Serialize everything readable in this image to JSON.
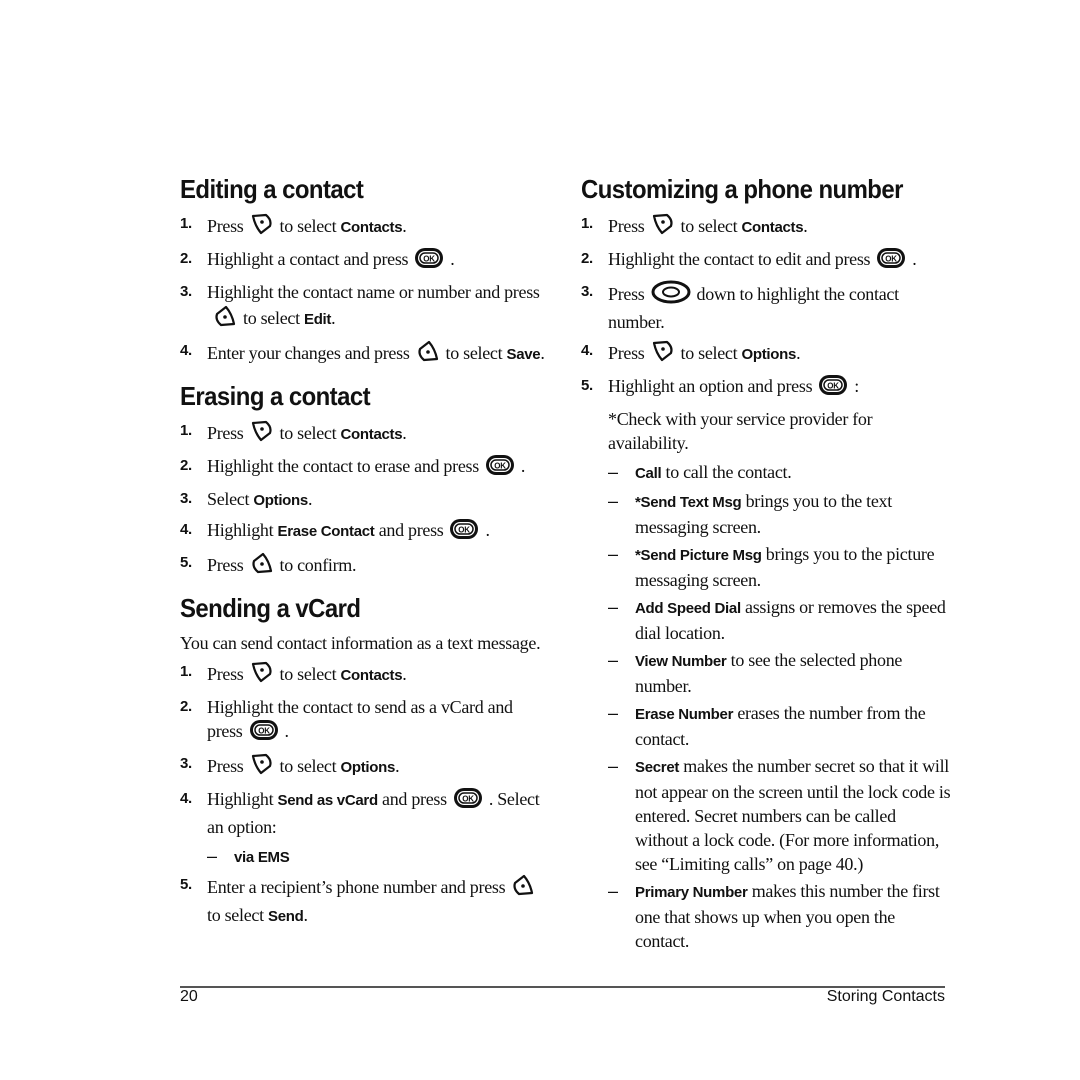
{
  "left_column": {
    "editing": {
      "title": "Editing a contact",
      "steps": [
        {
          "num": "1.",
          "a": "Press",
          "icon": "right-softkey-icon",
          "b": "to select ",
          "bold": "Contacts",
          "c": "."
        },
        {
          "num": "2.",
          "a": "Highlight a contact and press",
          "icon": "ok-key-icon",
          "c": "."
        },
        {
          "num": "3.",
          "a": "Highlight the contact name or number and press",
          "icon": "left-softkey-icon",
          "b": "to select ",
          "bold": "Edit",
          "c": "."
        },
        {
          "num": "4.",
          "a": "Enter your changes and press",
          "icon": "left-softkey-icon",
          "b": "to select ",
          "bold": "Save",
          "c": "."
        }
      ]
    },
    "erasing": {
      "title": "Erasing a contact",
      "steps": [
        {
          "num": "1.",
          "a": "Press",
          "icon": "right-softkey-icon",
          "b": "to select ",
          "bold": "Contacts",
          "c": "."
        },
        {
          "num": "2.",
          "a": "Highlight the contact to erase and press",
          "icon": "ok-key-icon",
          "c": "."
        },
        {
          "num": "3.",
          "a": "Select ",
          "bold": "Options",
          "c": "."
        },
        {
          "num": "4.",
          "a": "Highlight ",
          "bold": "Erase Contact",
          "b": " and press",
          "icon": "ok-key-icon",
          "c": "."
        },
        {
          "num": "5.",
          "a": "Press",
          "icon": "left-softkey-icon",
          "b": "to confirm."
        }
      ]
    },
    "vcard": {
      "title": "Sending a vCard",
      "intro": "You can send contact information as a text message.",
      "steps": [
        {
          "num": "1.",
          "a": "Press",
          "icon": "right-softkey-icon",
          "b": "to select ",
          "bold": "Contacts",
          "c": "."
        },
        {
          "num": "2.",
          "a": "Highlight the contact to send as a vCard and press",
          "icon": "ok-key-icon",
          "c": "."
        },
        {
          "num": "3.",
          "a": "Press",
          "icon": "right-softkey-icon",
          "b": "to select ",
          "bold": "Options",
          "c": "."
        },
        {
          "num": "4.",
          "a": "Highlight ",
          "bold": "Send as vCard",
          "b": " and press",
          "icon": "ok-key-icon",
          "c": ". Select an option:"
        },
        {
          "num": "5.",
          "a": "Enter a recipient’s phone number and press",
          "icon": "left-softkey-icon",
          "b": "to select ",
          "bold": "Send",
          "c": "."
        }
      ],
      "sub_option": {
        "dash": "–",
        "label": "via EMS"
      }
    }
  },
  "right_column": {
    "customizing": {
      "title": "Customizing a phone number",
      "steps": [
        {
          "num": "1.",
          "a": "Press",
          "icon": "right-softkey-icon",
          "b": "to select ",
          "bold": "Contacts",
          "c": "."
        },
        {
          "num": "2.",
          "a": "Highlight the contact to edit and press",
          "icon": "ok-key-icon",
          "c": "."
        },
        {
          "num": "3.",
          "a": "Press",
          "icon": "navigation-key-icon",
          "b": "down to highlight the contact number."
        },
        {
          "num": "4.",
          "a": "Press",
          "icon": "right-softkey-icon",
          "b": "to select ",
          "bold": "Options",
          "c": "."
        },
        {
          "num": "5.",
          "a": "Highlight an option and press",
          "icon": "ok-key-icon",
          "c": ":"
        }
      ],
      "note": "*Check with your service provider for availability.",
      "options": [
        {
          "dash": "–",
          "bold": "Call",
          "text": " to call the contact."
        },
        {
          "dash": "–",
          "bold": "*Send Text Msg",
          "text": " brings you to the text messaging screen."
        },
        {
          "dash": "–",
          "bold": "*Send Picture Msg",
          "text": " brings you to the picture messaging screen."
        },
        {
          "dash": "–",
          "bold": "Add Speed Dial",
          "text": " assigns or removes the speed dial location."
        },
        {
          "dash": "–",
          "bold": "View Number",
          "text": " to see the selected phone number."
        },
        {
          "dash": "–",
          "bold": "Erase Number",
          "text": " erases the number from the contact."
        },
        {
          "dash": "–",
          "bold": "Secret",
          "text": " makes the number secret so that it will not appear on the screen until the lock code is entered. Secret numbers can be called without a lock code. (For more information, see “Limiting calls” on page 40.)"
        },
        {
          "dash": "–",
          "bold": "Primary Number",
          "text": " makes this number the first one that shows up when you open the contact."
        }
      ]
    }
  },
  "footer": {
    "page_number": "20",
    "section": "Storing Contacts"
  }
}
